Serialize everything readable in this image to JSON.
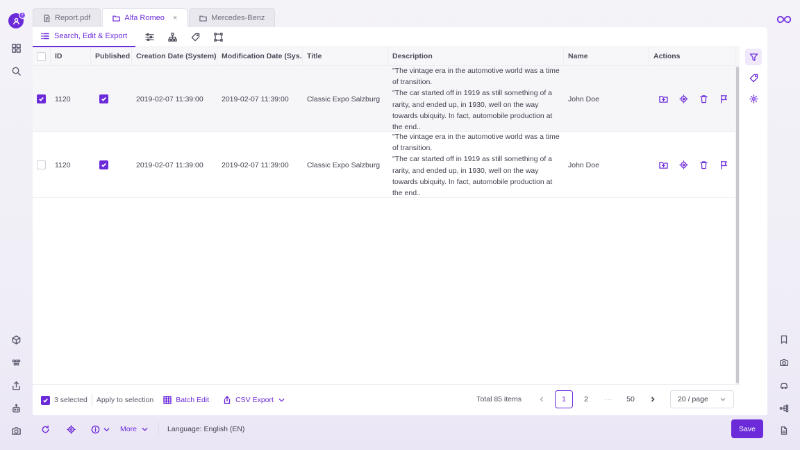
{
  "left_rail": {
    "avatar_badge": "1"
  },
  "tabs": [
    {
      "label": "Report.pdf",
      "icon": "document-icon"
    },
    {
      "label": "Alfa Romeo",
      "icon": "folder-icon",
      "close": "×"
    },
    {
      "label": "Mercedes-Benz",
      "icon": "folder-icon"
    }
  ],
  "subtabs": {
    "main_label": "Search, Edit & Export"
  },
  "grid": {
    "columns": [
      "ID",
      "Published",
      "Creation Date (System)",
      "Modification Date (Sys..)",
      "Title",
      "Description",
      "Name",
      "Actions"
    ],
    "rows": [
      {
        "selected": true,
        "id": "1120",
        "published": true,
        "created": "2019-02-07 11:39:00",
        "modified": "2019-02-07 11:39:00",
        "title": "Classic Expo Salzburg",
        "description": "\"The vintage era in the automotive world was a time of transition.\n\"The car started off in 1919 as still something of a rarity, and ended up, in 1930, well on the way towards ubiquity. In fact, automobile production at the end..",
        "name": "John Doe"
      },
      {
        "selected": false,
        "id": "1120",
        "published": true,
        "created": "2019-02-07 11:39:00",
        "modified": "2019-02-07 11:39:00",
        "title": "Classic Expo Salzburg",
        "description": "\"The vintage era in the automotive world was a time of transition.\n\"The car started off in 1919 as still something of a rarity, and ended up, in 1930, well on the way towards ubiquity. In fact, automobile production at the end..",
        "name": "John Doe"
      }
    ]
  },
  "footer": {
    "selected_count": "3 selected",
    "apply_label": "Apply to selection",
    "batch_edit": "Batch Edit",
    "csv_export": "CSV Export",
    "total": "Total 85 items",
    "pages": [
      "1",
      "2",
      "···",
      "50"
    ],
    "current_page": 1,
    "per_page": "20 / page"
  },
  "bottombar": {
    "more": "More",
    "language": "Language: English (EN)",
    "save": "Save"
  },
  "colors": {
    "accent": "#6c2bd9"
  }
}
